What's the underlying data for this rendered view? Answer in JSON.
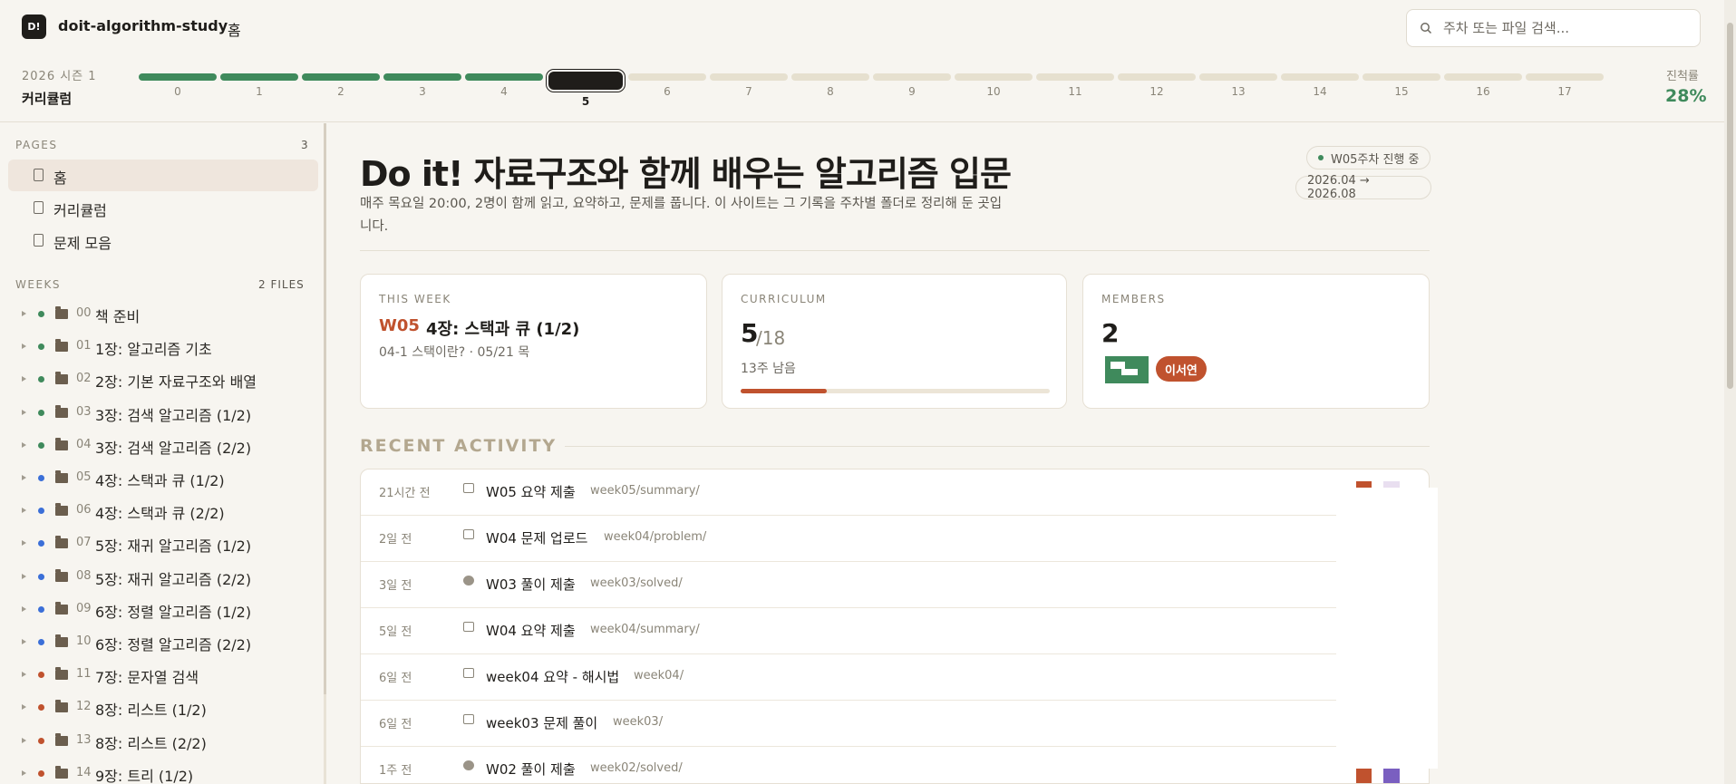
{
  "header": {
    "logo_text": "D!",
    "app_name": "doit-algorithm-study",
    "breadcrumb": "홈",
    "search_placeholder": "주차 또는 파일 검색...",
    "season": "2026 시즌 1",
    "curriculum_label": "커리큘럼",
    "progress_label": "진척률",
    "progress_value": "28%",
    "progress_fraction": 0.28
  },
  "timeline": {
    "weeks": [
      "0",
      "1",
      "2",
      "3",
      "4",
      "5",
      "6",
      "7",
      "8",
      "9",
      "10",
      "11",
      "12",
      "13",
      "14",
      "15",
      "16",
      "17"
    ],
    "current_week": "5",
    "completed_through": 4
  },
  "sidebar": {
    "pages_title": "PAGES",
    "pages_count": "3",
    "pages": [
      {
        "label": "홈",
        "active": true
      },
      {
        "label": "커리큘럼",
        "active": false
      },
      {
        "label": "문제 모음",
        "active": false
      }
    ],
    "weeks_title": "WEEKS",
    "weeks_count": "2 FILES",
    "weeks": [
      {
        "num": "00",
        "label": "책 준비",
        "status": "done"
      },
      {
        "num": "01",
        "label": "1장: 알고리즘 기초",
        "status": "done"
      },
      {
        "num": "02",
        "label": "2장: 기본 자료구조와 배열",
        "status": "done"
      },
      {
        "num": "03",
        "label": "3장: 검색 알고리즘 (1/2)",
        "status": "done"
      },
      {
        "num": "04",
        "label": "3장: 검색 알고리즘 (2/2)",
        "status": "done"
      },
      {
        "num": "05",
        "label": "4장: 스택과 큐 (1/2)",
        "status": "in-progress"
      },
      {
        "num": "06",
        "label": "4장: 스택과 큐 (2/2)",
        "status": "in-progress"
      },
      {
        "num": "07",
        "label": "5장: 재귀 알고리즘 (1/2)",
        "status": "in-progress"
      },
      {
        "num": "08",
        "label": "5장: 재귀 알고리즘 (2/2)",
        "status": "in-progress"
      },
      {
        "num": "09",
        "label": "6장: 정렬 알고리즘 (1/2)",
        "status": "in-progress"
      },
      {
        "num": "10",
        "label": "6장: 정렬 알고리즘 (2/2)",
        "status": "in-progress"
      },
      {
        "num": "11",
        "label": "7장: 문자열 검색",
        "status": "upcoming"
      },
      {
        "num": "12",
        "label": "8장: 리스트 (1/2)",
        "status": "upcoming"
      },
      {
        "num": "13",
        "label": "8장: 리스트 (2/2)",
        "status": "upcoming"
      },
      {
        "num": "14",
        "label": "9장: 트리 (1/2)",
        "status": "upcoming"
      }
    ]
  },
  "main": {
    "title": "Do it! 자료구조와 함께 배우는 알고리즘 입문",
    "subtitle": "매주 목요일 20:00, 2명이 함께 읽고, 요약하고, 문제를 풉니다. 이 사이트는 그 기록을 주차별 폴더로 정리해 둔 곳입니다.",
    "status_pill": "W05주차 진행 중",
    "date_range": "2026.04 → 2026.08",
    "this_week": {
      "head": "THIS WEEK",
      "week": "W05",
      "title": "4장: 스택과 큐 (1/2)",
      "sub": "04-1 스택이란? · 05/21 목"
    },
    "curriculum": {
      "head": "CURRICULUM",
      "current": "5",
      "total": "/18",
      "remaining": "13주 남음",
      "fraction": 0.28
    },
    "members": {
      "head": "MEMBERS",
      "count": "2",
      "badge": "이서연"
    },
    "recent_title": "RECENT ACTIVITY",
    "activities": [
      {
        "time": "21시간 전",
        "icon": "markdown-icon",
        "title": "W05 요약 제출",
        "path": "week05/summary/"
      },
      {
        "time": "2일 전",
        "icon": "markdown-icon",
        "title": "W04 문제 업로드",
        "path": "week04/problem/"
      },
      {
        "time": "3일 전",
        "icon": "python-icon",
        "title": "W03 풀이 제출",
        "path": "week03/solved/"
      },
      {
        "time": "5일 전",
        "icon": "markdown-icon",
        "title": "W04 요약 제출",
        "path": "week04/summary/"
      },
      {
        "time": "6일 전",
        "icon": "markdown-icon",
        "title": "week04 요약 - 해시법",
        "path": "week04/"
      },
      {
        "time": "6일 전",
        "icon": "markdown-icon",
        "title": "week03 문제 풀이",
        "path": "week03/"
      },
      {
        "time": "1주 전",
        "icon": "python-icon",
        "title": "W02 풀이 제출",
        "path": "week02/solved/"
      }
    ]
  },
  "colors": {
    "accent": "#c0522e",
    "done": "#3f8a5c",
    "in_progress": "#3b6fd8",
    "upcoming": "#c0522e"
  }
}
